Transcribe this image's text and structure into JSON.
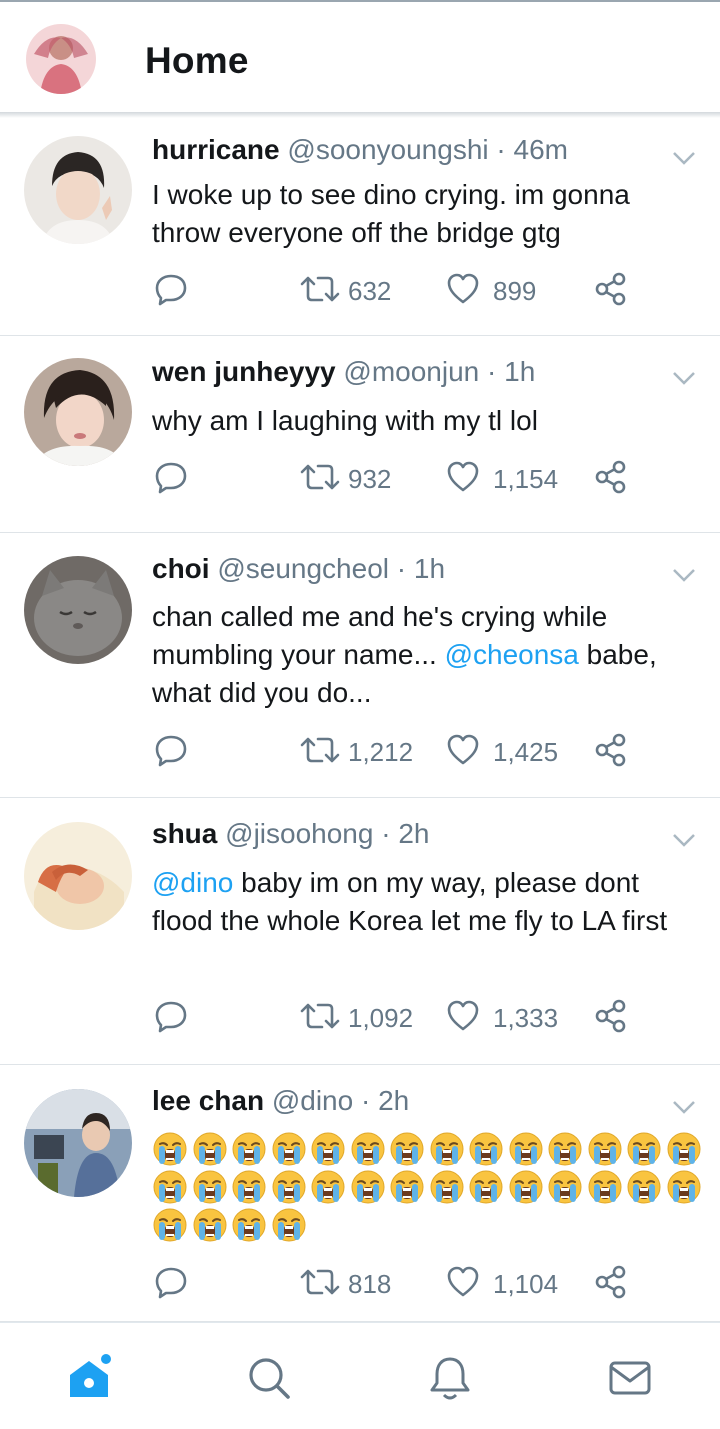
{
  "header": {
    "title": "Home"
  },
  "tweets": [
    {
      "name": "hurricane",
      "handle": "@soonyoungshi",
      "time": "· 46m",
      "text": "I woke up to see dino crying. im gonna throw everyone off the bridge gtg",
      "retweets": "632",
      "likes": "899"
    },
    {
      "name": "wen junheyyy",
      "handle": "@moonjun",
      "time": "· 1h",
      "text": "why am I laughing with my tl lol",
      "retweets": "932",
      "likes": "1,154"
    },
    {
      "name": "choi",
      "handle": "@seungcheol",
      "time": "· 1h",
      "text_before": "chan called me and he's crying while mumbling your name...",
      "mention": "@cheonsa",
      "text_after": "babe, what did you do...",
      "retweets": "1,212",
      "likes": "1,425"
    },
    {
      "name": "shua",
      "handle": "@jisoohong",
      "time": "· 2h",
      "mention": "@dino",
      "text_after": "baby im on my way, please dont flood the whole Korea let me fly to LA first",
      "retweets": "1,092",
      "likes": "1,333"
    },
    {
      "name": "lee chan",
      "handle": "@dino",
      "time": "· 2h",
      "emoji": "😭",
      "emoji_count": 32,
      "retweets": "818",
      "likes": "1,104"
    }
  ],
  "tabs": [
    "home-icon",
    "search-icon",
    "bell-icon",
    "mail-icon"
  ],
  "colors": {
    "accent": "#1da1f2",
    "text": "#14171a",
    "muted": "#657786",
    "divider": "#dfe4e8"
  }
}
